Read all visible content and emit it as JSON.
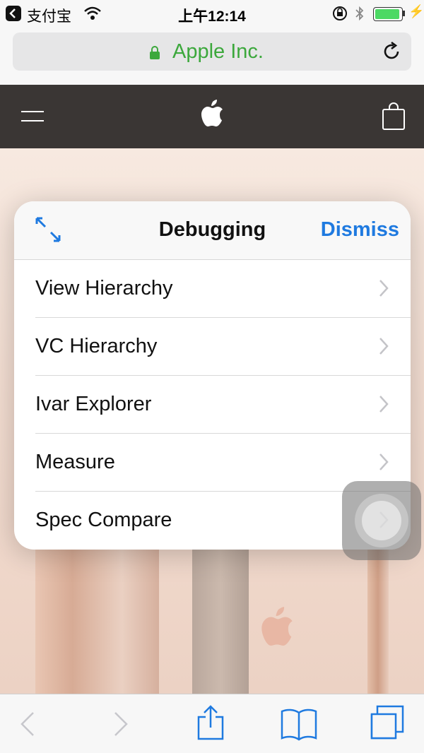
{
  "status_bar": {
    "back_app": "支付宝",
    "time": "上午12:14",
    "battery_level": 1.0,
    "icons": [
      "back-to-app-icon",
      "wifi-icon",
      "orientation-lock-icon",
      "bluetooth-icon",
      "battery-icon",
      "charging-icon"
    ]
  },
  "browser": {
    "url_label": "Apple Inc.",
    "colors": {
      "url_text": "#3ca83c",
      "lock": "#3ca83c"
    }
  },
  "site_nav": {
    "icons": [
      "menu-icon",
      "apple-logo-icon",
      "shopping-bag-icon"
    ],
    "background": "#3a3634"
  },
  "debug_panel": {
    "title": "Debugging",
    "dismiss_label": "Dismiss",
    "accent": "#1f7ae0",
    "items": [
      {
        "label": "View Hierarchy"
      },
      {
        "label": "VC Hierarchy"
      },
      {
        "label": "Ivar Explorer"
      },
      {
        "label": "Measure"
      },
      {
        "label": "Spec Compare"
      }
    ]
  },
  "toolbar": {
    "icons": [
      "back-icon",
      "forward-icon",
      "share-icon",
      "bookmarks-icon",
      "tabs-icon"
    ]
  }
}
